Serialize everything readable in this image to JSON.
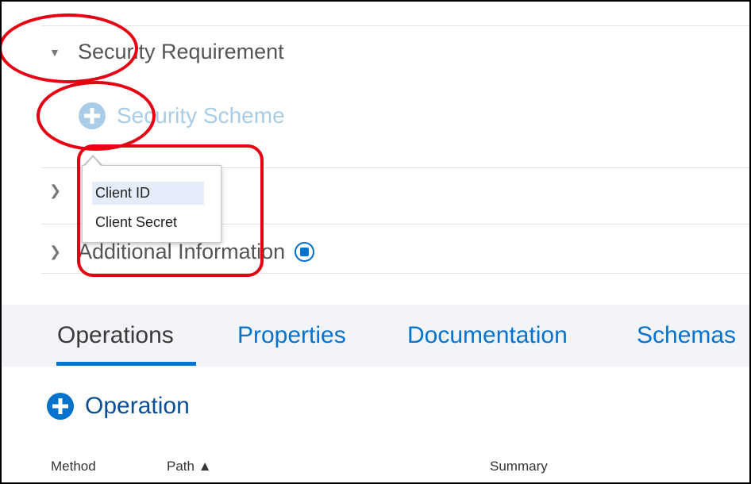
{
  "sections": {
    "security_requirement": {
      "label": "Security Requirement",
      "caret_icon": "caret-down-icon"
    },
    "security_scheme": {
      "label": "Security Scheme",
      "icon": "plus-circle-icon",
      "color": "#a9cce8"
    },
    "hidden_section": {
      "caret_icon": "caret-right-icon"
    },
    "additional_information": {
      "label": "Additional Information",
      "caret_icon": "caret-right-icon",
      "icon": "puzzle-circle-icon"
    }
  },
  "dropdown": {
    "items": [
      "Client ID",
      "Client Secret"
    ],
    "highlighted_index": 0
  },
  "tabs": [
    {
      "label": "Operations",
      "active": true
    },
    {
      "label": "Properties",
      "active": false
    },
    {
      "label": "Documentation",
      "active": false
    },
    {
      "label": "Schemas",
      "active": false
    }
  ],
  "add_operation": {
    "label": "Operation",
    "icon": "plus-circle-icon"
  },
  "table": {
    "columns": [
      "Method",
      "Path ▲",
      "Summary"
    ]
  },
  "colors": {
    "accent": "#0572ce",
    "annotation_red": "#e60012",
    "tabs_background": "#f2f4f7",
    "highlight": "#e4edf9"
  }
}
